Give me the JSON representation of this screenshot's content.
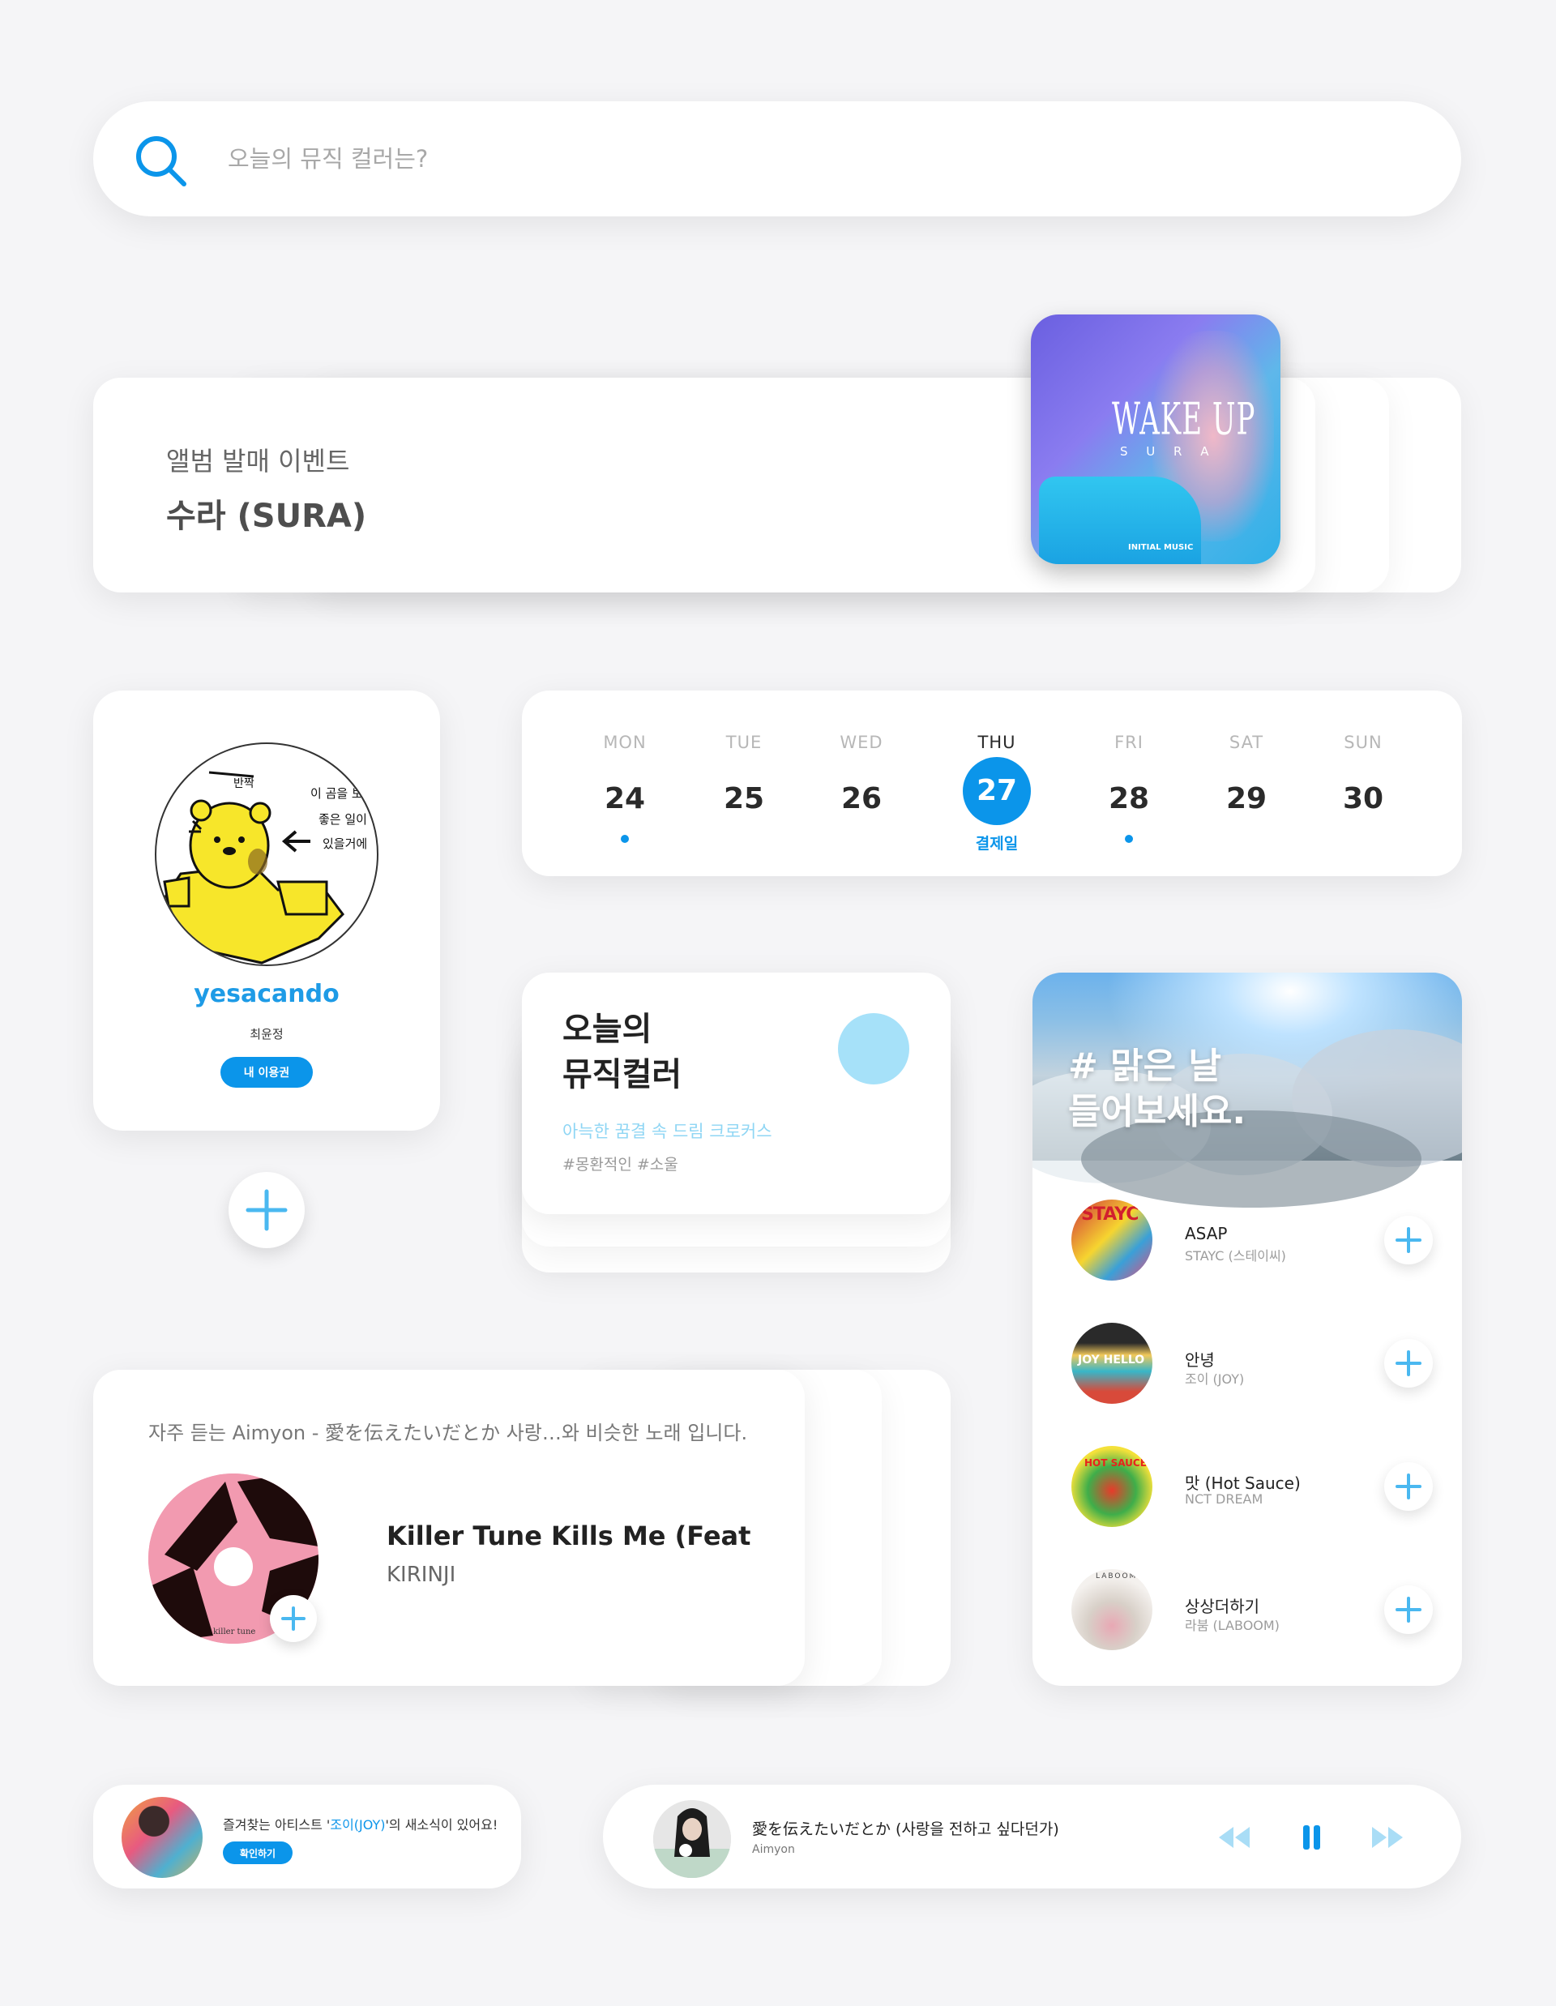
{
  "search": {
    "placeholder": "오늘의 뮤직 컬러는?"
  },
  "event": {
    "subtitle": "앨범 발매 이벤트",
    "title": "수라 (SURA)",
    "cover_title": "WAKE UP",
    "cover_artist": "S U R A",
    "cover_label": "INITIAL MUSIC"
  },
  "profile": {
    "avatar_text": [
      "반짝",
      "이 곰을 보",
      "좋은 일이",
      "있을거에"
    ],
    "username": "yesacando",
    "name": "최윤정",
    "pass_label": "내 이용권"
  },
  "calendar": {
    "days": [
      {
        "dow": "MON",
        "num": "24",
        "dot": true
      },
      {
        "dow": "TUE",
        "num": "25",
        "dot": false
      },
      {
        "dow": "WED",
        "num": "26",
        "dot": false
      },
      {
        "dow": "THU",
        "num": "27",
        "dot": false,
        "active": true,
        "label": "결제일"
      },
      {
        "dow": "FRI",
        "num": "28",
        "dot": true
      },
      {
        "dow": "SAT",
        "num": "29",
        "dot": false
      },
      {
        "dow": "SUN",
        "num": "30",
        "dot": false
      }
    ]
  },
  "music_color": {
    "title_line1": "오늘의",
    "title_line2": "뮤직컬러",
    "description": "아늑한 꿈결 속 드림 크로커스",
    "tags": "#몽환적인 #소울",
    "color": "#a6e1f9"
  },
  "playlist": {
    "heading_line1": "# 맑은 날",
    "heading_line2": "들어보세요.",
    "tracks": [
      {
        "name": "ASAP",
        "artist": "STAYC (스테이씨)",
        "cover_text": "STAYC"
      },
      {
        "name": "안녕",
        "artist": "조이 (JOY)",
        "cover_text": "JOY HELLO"
      },
      {
        "name": "맛 (Hot Sauce)",
        "artist": "NCT DREAM",
        "cover_text": "HOT SAUCE"
      },
      {
        "name": "상상더하기",
        "artist": "라붐 (LABOOM)",
        "cover_text": "LABOOM"
      }
    ]
  },
  "recommendation": {
    "intro": "자주 듣는 Aimyon - 愛を伝えたいだとか 사랑…와 비슷한 노래 입니다.",
    "song": "Killer Tune Kills Me (Feat.Y…",
    "artist": "KIRINJI",
    "cover_text": "killer tune"
  },
  "notification": {
    "message_prefix": "즐겨찾는 아티스트 '",
    "artist": "조이(JOY)",
    "message_suffix": "'의 새소식이 있어요!",
    "button": "확인하기"
  },
  "player": {
    "song": "愛を伝えたいだとか (사랑을 전하고 싶다던가)",
    "artist": "Aimyon"
  },
  "colors": {
    "accent": "#0b95ea",
    "light_accent": "#8fd6f4",
    "background": "#f5f5f7"
  }
}
